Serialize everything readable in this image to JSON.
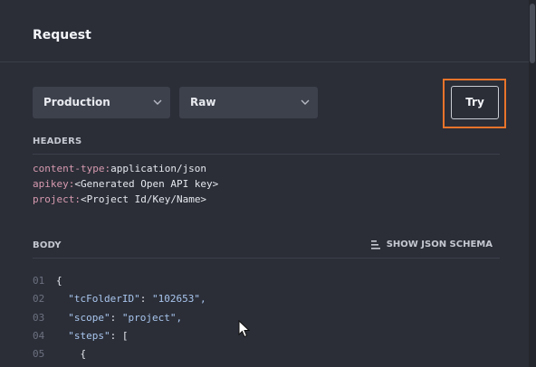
{
  "panel": {
    "title": "Request"
  },
  "controls": {
    "environment": "Production",
    "format": "Raw",
    "try_label": "Try"
  },
  "headers_section": {
    "label": "HEADERS",
    "lines": [
      {
        "key": "content-type:",
        "value": "application/json"
      },
      {
        "key": "apikey:",
        "value": "<Generated Open API key>"
      },
      {
        "key": "project:",
        "value": "<Project Id/Key/Name>"
      }
    ]
  },
  "body_section": {
    "label": "BODY",
    "schema_label": "SHOW JSON SCHEMA",
    "lines": [
      {
        "num": "01",
        "indent": "",
        "key": "",
        "sep": "",
        "value": "{"
      },
      {
        "num": "02",
        "indent": "  ",
        "key": "\"tcFolderID\"",
        "sep": ": ",
        "value": "\"102653\","
      },
      {
        "num": "03",
        "indent": "  ",
        "key": "\"scope\"",
        "sep": ": ",
        "value": "\"project\","
      },
      {
        "num": "04",
        "indent": "  ",
        "key": "\"steps\"",
        "sep": ": ",
        "value": "["
      },
      {
        "num": "05",
        "indent": "    ",
        "key": "",
        "sep": "",
        "value": "{"
      }
    ]
  },
  "colors": {
    "background": "#2b2e37",
    "select_bg": "#3d414c",
    "highlight": "#e8742a",
    "header_key": "#d79ab0",
    "json_key": "#a9c6ef"
  },
  "icons": [
    "chevron-down-icon",
    "list-icon",
    "mouse-pointer-icon"
  ]
}
